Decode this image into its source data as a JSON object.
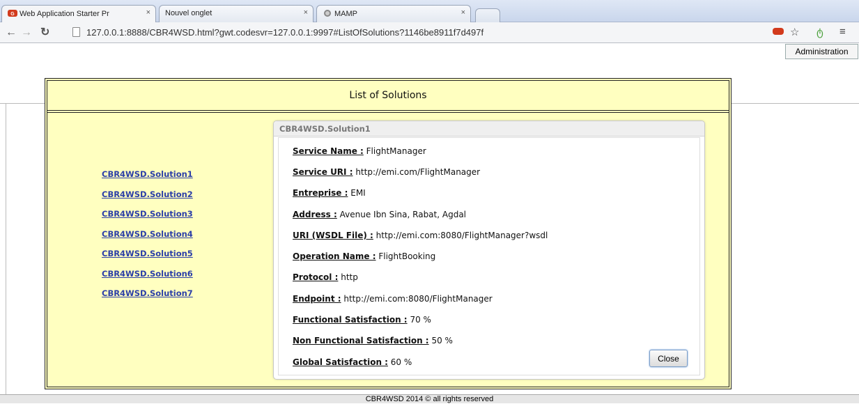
{
  "browser": {
    "tabs": [
      {
        "label": "Web Application Starter Pr",
        "active": true
      },
      {
        "label": "Nouvel onglet",
        "active": false
      },
      {
        "label": "MAMP",
        "active": false
      }
    ],
    "url": "127.0.0.1:8888/CBR4WSD.html?gwt.codesvr=127.0.0.1:9997#ListOfSolutions?1146be8911f7d497f"
  },
  "admin_tooltip": "Administration",
  "panel": {
    "title": "List of Solutions",
    "solutions": [
      "CBR4WSD.Solution1",
      "CBR4WSD.Solution2",
      "CBR4WSD.Solution3",
      "CBR4WSD.Solution4",
      "CBR4WSD.Solution5",
      "CBR4WSD.Solution6",
      "CBR4WSD.Solution7"
    ]
  },
  "detail": {
    "title": "CBR4WSD.Solution1",
    "fields": [
      {
        "label": "Service Name :",
        "value": "FlightManager"
      },
      {
        "label": "Service URI :",
        "value": "http://emi.com/FlightManager"
      },
      {
        "label": "Entreprise :",
        "value": "EMI"
      },
      {
        "label": "Address :",
        "value": "Avenue Ibn Sina, Rabat, Agdal"
      },
      {
        "label": "URI (WSDL File) :",
        "value": "http://emi.com:8080/FlightManager?wsdl"
      },
      {
        "label": "Operation Name :",
        "value": "FlightBooking"
      },
      {
        "label": "Protocol :",
        "value": "http"
      },
      {
        "label": "Endpoint :",
        "value": "http://emi.com:8080/FlightManager"
      },
      {
        "label": "Functional Satisfaction :",
        "value": "70 %"
      },
      {
        "label": "Non Functional Satisfaction :",
        "value": "50 %"
      },
      {
        "label": "Global Satisfaction :",
        "value": "60 %"
      }
    ],
    "close_label": "Close"
  },
  "footer": "CBR4WSD 2014 © all rights reserved"
}
